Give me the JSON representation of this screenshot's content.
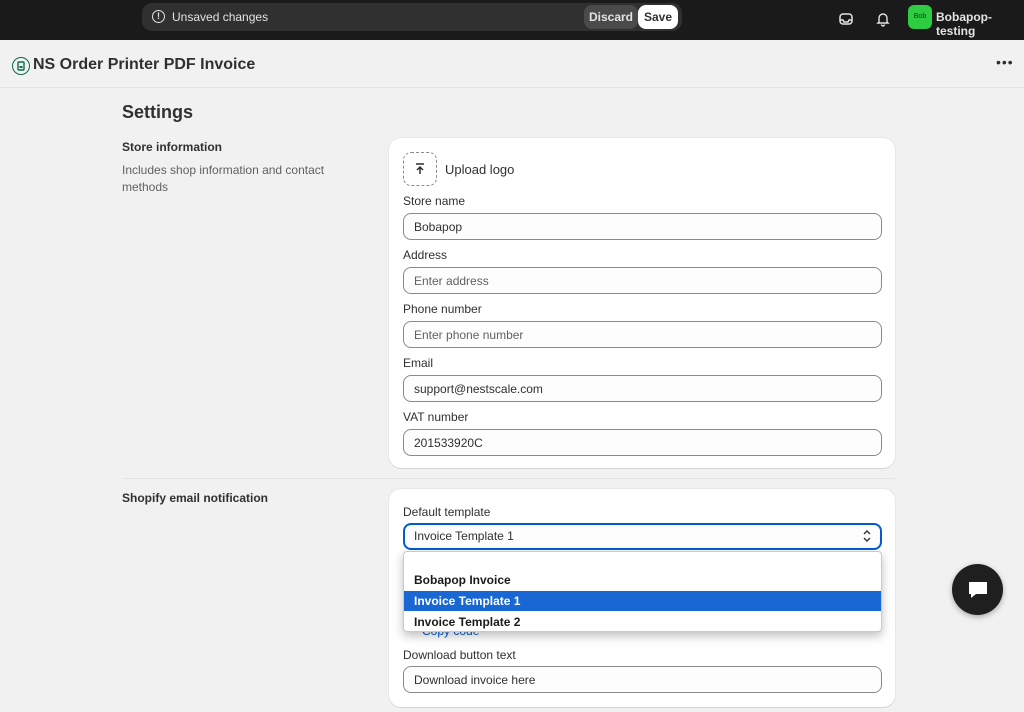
{
  "topbar": {
    "unsaved_text": "Unsaved changes",
    "discard_label": "Discard",
    "save_label": "Save",
    "user_initials": "Bob",
    "user_name": "Bobapop-testing"
  },
  "app": {
    "title": "NS Order Printer PDF Invoice",
    "more_icon": "ellipsis-icon"
  },
  "page": {
    "title": "Settings"
  },
  "store_info": {
    "section_title": "Store information",
    "section_desc": "Includes shop information and contact methods",
    "upload_label": "Upload logo",
    "store_name_label": "Store name",
    "store_name_value": "Bobapop",
    "address_label": "Address",
    "address_placeholder": "Enter address",
    "phone_label": "Phone number",
    "phone_placeholder": "Enter phone number",
    "email_label": "Email",
    "email_value": "support@nestscale.com",
    "vat_label": "VAT number",
    "vat_value": "201533920C"
  },
  "email_notification": {
    "section_title": "Shopify email notification",
    "template_label": "Default template",
    "template_selected": "Invoice Template 1",
    "options": [
      "Bobapop Invoice",
      "Invoice Template 1",
      "Invoice Template 2"
    ],
    "copy_code_label": "Copy code",
    "download_label": "Download button text",
    "download_value": "Download invoice here"
  },
  "colors": {
    "accent": "#005bd3",
    "selected_option": "#1967d2",
    "topbar": "#1a1a1a",
    "avatar": "#2ecc40"
  }
}
